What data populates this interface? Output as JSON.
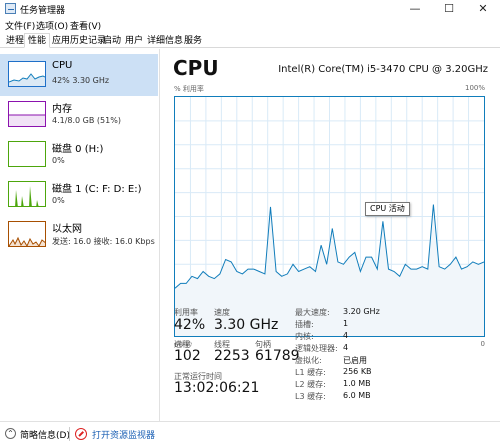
{
  "window": {
    "title": "任务管理器",
    "minimize_glyph": "—",
    "maximize_glyph": "☐",
    "close_glyph": "✕"
  },
  "menu": {
    "items": [
      "文件(F)",
      "选项(O)",
      "查看(V)"
    ]
  },
  "tabs": {
    "items": [
      "进程",
      "性能",
      "应用历史记录",
      "启动",
      "用户",
      "详细信息",
      "服务"
    ],
    "active": "性能"
  },
  "sidebar": {
    "items": [
      {
        "title": "CPU",
        "subtitle": "42% 3.30 GHz",
        "color": "#117dbb"
      },
      {
        "title": "内存",
        "subtitle": "4.1/8.0 GB (51%)",
        "color": "#8b12ae"
      },
      {
        "title": "磁盘 0 (H:)",
        "subtitle": "0%",
        "color": "#4da60c"
      },
      {
        "title": "磁盘 1 (C: F: D: E:)",
        "subtitle": "0%",
        "color": "#4da60c"
      },
      {
        "title": "以太网",
        "subtitle": "发送: 16.0 接收: 16.0 Kbps",
        "color": "#a74f01"
      }
    ]
  },
  "main": {
    "title": "CPU",
    "model": "Intel(R) Core(TM) i5-3470 CPU @ 3.20GHz",
    "graph_label_left": "% 利用率",
    "graph_label_right": "100%",
    "time_left": "60 秒",
    "time_right": "0",
    "tooltip": "CPU 活动"
  },
  "stats": {
    "utilization_label": "利用率",
    "utilization_value": "42%",
    "speed_label": "速度",
    "speed_value": "3.30 GHz",
    "processes_label": "进程",
    "processes_value": "102",
    "threads_label": "线程",
    "threads_value": "2253",
    "handles_label": "句柄",
    "handles_value": "61789",
    "uptime_label": "正常运行时间",
    "uptime_value": "13:02:06:21"
  },
  "specs": [
    {
      "label": "最大速度:",
      "value": "3.20 GHz"
    },
    {
      "label": "插槽:",
      "value": "1"
    },
    {
      "label": "内核:",
      "value": "4"
    },
    {
      "label": "逻辑处理器:",
      "value": "4"
    },
    {
      "label": "虚拟化:",
      "value": "已启用"
    },
    {
      "label": "L1 缓存:",
      "value": "256 KB"
    },
    {
      "label": "L2 缓存:",
      "value": "1.0 MB"
    },
    {
      "label": "L3 缓存:",
      "value": "6.0 MB"
    }
  ],
  "status": {
    "details_label": "简略信息(D)",
    "monitor_label": "打开资源监视器"
  },
  "cpu_history_percent": [
    20,
    22,
    22,
    25,
    24,
    27,
    25,
    24,
    26,
    32,
    31,
    27,
    26,
    28,
    28,
    27,
    26,
    54,
    27,
    25,
    26,
    30,
    27,
    28,
    29,
    27,
    38,
    30,
    45,
    31,
    30,
    33,
    35,
    27,
    33,
    33,
    28,
    48,
    28,
    27,
    25,
    30,
    28,
    28,
    29,
    28,
    55,
    29,
    28,
    30,
    33,
    28,
    29,
    31,
    30,
    31
  ]
}
